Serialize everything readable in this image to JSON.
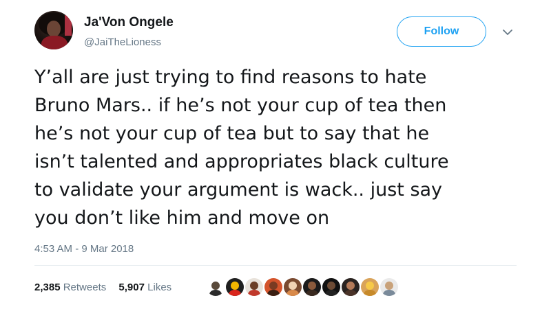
{
  "user": {
    "display_name": "Ja'Von Ongele",
    "handle": "@JaiTheLioness",
    "avatar_icon": "profile-photo"
  },
  "follow_button": {
    "label": "Follow",
    "color": "#1da1f2"
  },
  "menu_icon": "chevron-down-icon",
  "tweet": {
    "lines": [
      "Y’all are just trying to find reasons to hate",
      "Bruno Mars.. if he’s not your cup of tea then",
      "he’s not your cup of tea but to say that he",
      "isn’t talented and appropriates black culture",
      "to validate your argument is wack.. just say",
      "you don’t like him and move on"
    ],
    "timestamp": "4:53 AM - 9 Mar 2018"
  },
  "stats": {
    "retweets_count": "2,385",
    "retweets_label": "Retweets",
    "likes_count": "5,907",
    "likes_label": "Likes"
  },
  "likers": [
    {
      "name": "liker-avatar-1",
      "bg": "#ffffff",
      "head": "#5a4a3a",
      "body": "#2b2b2b"
    },
    {
      "name": "liker-avatar-2",
      "bg": "#1f1f1f",
      "head": "#f2b600",
      "body": "#d9261c"
    },
    {
      "name": "liker-avatar-3",
      "bg": "#e8e2da",
      "head": "#6b3e26",
      "body": "#c0392b"
    },
    {
      "name": "liker-avatar-4",
      "bg": "#d4532b",
      "head": "#7a3b22",
      "body": "#3a1f12"
    },
    {
      "name": "liker-avatar-5",
      "bg": "#7a4a30",
      "head": "#f0d2b4",
      "body": "#d98a4a"
    },
    {
      "name": "liker-avatar-6",
      "bg": "#1a1a1a",
      "head": "#8a5a3c",
      "body": "#3a2a20"
    },
    {
      "name": "liker-avatar-7",
      "bg": "#111111",
      "head": "#6d4b35",
      "body": "#222222"
    },
    {
      "name": "liker-avatar-8",
      "bg": "#2a2320",
      "head": "#b47a58",
      "body": "#4a3328"
    },
    {
      "name": "liker-avatar-9",
      "bg": "#d9a35a",
      "head": "#f7c948",
      "body": "#c78a2a"
    },
    {
      "name": "liker-avatar-10",
      "bg": "#eaeaea",
      "head": "#c9a27a",
      "body": "#7a8a9a"
    }
  ],
  "colors": {
    "text_primary": "#14171a",
    "text_secondary": "#657786",
    "accent": "#1da1f2"
  }
}
